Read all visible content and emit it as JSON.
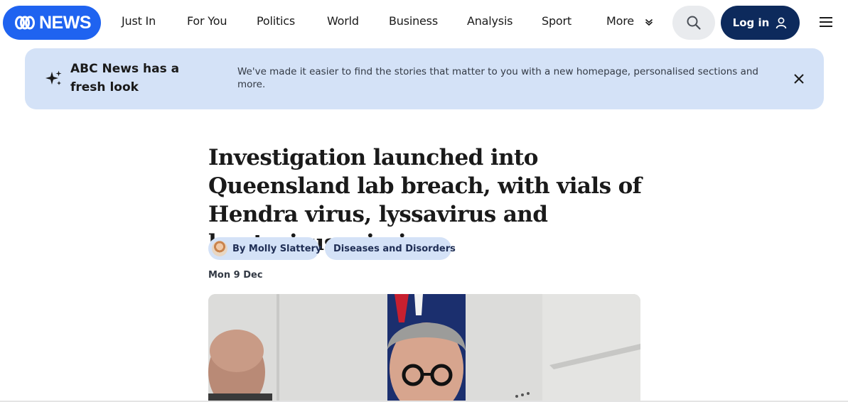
{
  "header": {
    "logo_text": "NEWS",
    "nav": [
      {
        "label": "Just In"
      },
      {
        "label": "For You"
      },
      {
        "label": "Politics"
      },
      {
        "label": "World"
      },
      {
        "label": "Business"
      },
      {
        "label": "Analysis"
      },
      {
        "label": "Sport"
      },
      {
        "label": "More"
      }
    ],
    "login_label": "Log in",
    "icons": {
      "search": "search-icon",
      "user": "user-icon",
      "menu": "hamburger-menu-icon",
      "more": "chevron-down-icon"
    }
  },
  "banner": {
    "title": "ABC News has a fresh look",
    "text": "We've made it easier to find the stories that matter to you with a new homepage, personalised sections and more.",
    "icons": {
      "sparkle": "sparkle-icon",
      "close": "close-icon"
    }
  },
  "article": {
    "headline": "Investigation launched into Queensland lab breach, with vials of Hendra virus, lyssavirus and hantavirus missing",
    "author_label": "By Molly Slattery",
    "topic_label": "Diseases and Disorders",
    "date": "Mon 9 Dec"
  },
  "colors": {
    "brand_blue": "#1f63f0",
    "login_navy": "#0d2a5c",
    "banner_bg": "#d4e2f7"
  }
}
